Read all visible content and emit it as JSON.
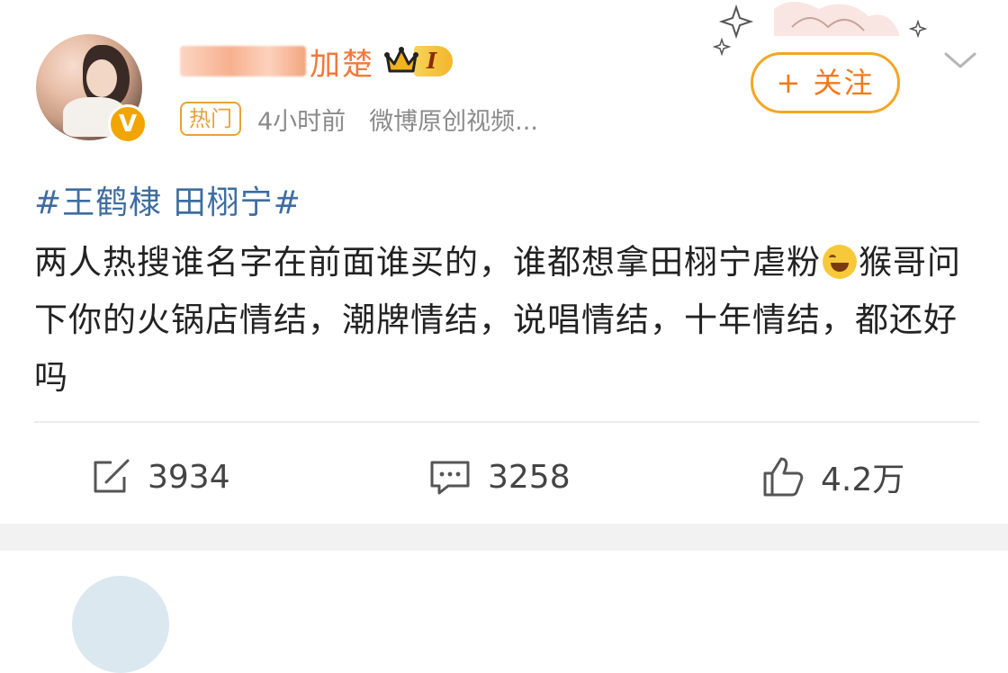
{
  "post": {
    "username_visible_part": "加楚",
    "level": "I",
    "hot_tag": "热门",
    "time": "4小时前",
    "source": "微博原创视频...",
    "follow_label": "+ 关注",
    "hashtag": "#王鹤棣 田栩宁#",
    "text_before_emoji": "两人热搜谁名字在前面谁买的，谁都想拿田栩宁虐粉",
    "text_after_emoji": "猴哥问下你的火锅店情结，潮牌情结，说唱情结，十年情结，都还好吗",
    "emoji": "laughing-crying-emoji"
  },
  "actions": {
    "repost_count": "3934",
    "comment_count": "3258",
    "like_count": "4.2万"
  },
  "icons": {
    "verified": "V"
  },
  "colors": {
    "accent_orange": "#f4a623",
    "link_blue": "#3e6d9f",
    "gray_text": "#8a8a8a"
  }
}
